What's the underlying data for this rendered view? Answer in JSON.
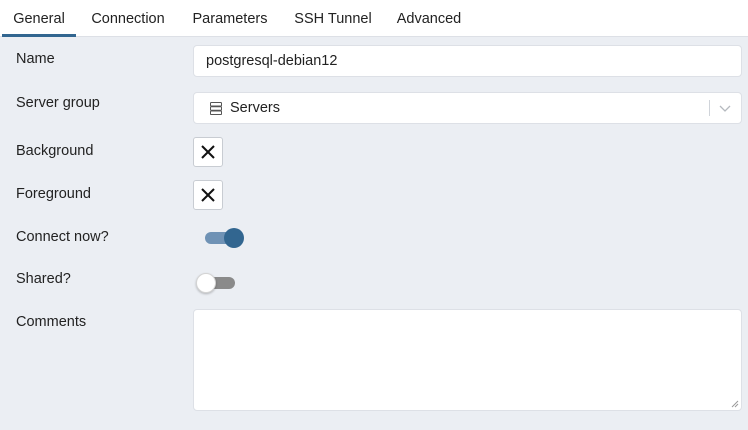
{
  "tabs": [
    {
      "label": "General",
      "active": true
    },
    {
      "label": "Connection",
      "active": false
    },
    {
      "label": "Parameters",
      "active": false
    },
    {
      "label": "SSH Tunnel",
      "active": false
    },
    {
      "label": "Advanced",
      "active": false
    }
  ],
  "form": {
    "name": {
      "label": "Name",
      "value": "postgresql-debian12"
    },
    "server_group": {
      "label": "Server group",
      "value": "Servers",
      "icon": "server-icon"
    },
    "background": {
      "label": "Background",
      "icon": "x-icon"
    },
    "foreground": {
      "label": "Foreground",
      "icon": "x-icon"
    },
    "connect_now": {
      "label": "Connect now?",
      "checked": true
    },
    "shared": {
      "label": "Shared?",
      "checked": false
    },
    "comments": {
      "label": "Comments",
      "value": ""
    }
  },
  "colors": {
    "accent": "#326690",
    "panel_bg": "#ebeef3"
  }
}
